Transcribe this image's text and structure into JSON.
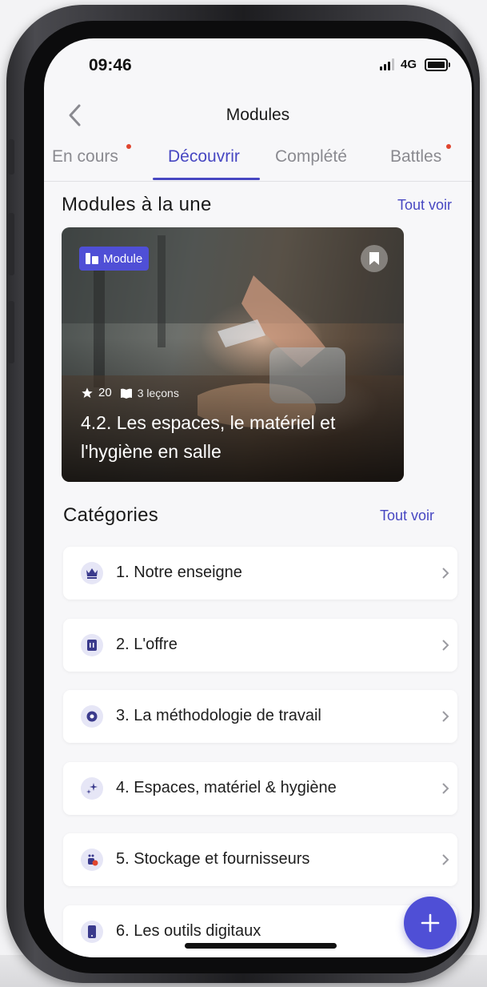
{
  "status_bar": {
    "time": "09:46",
    "network": "4G"
  },
  "nav": {
    "title": "Modules"
  },
  "tabs": [
    {
      "label": "En cours",
      "dot": true
    },
    {
      "label": "Découvrir",
      "active": true
    },
    {
      "label": "Complété"
    },
    {
      "label": "Battles",
      "dot": true
    }
  ],
  "featured": {
    "title": "Modules à la une",
    "see_all": "Tout voir",
    "card": {
      "badge": "Module",
      "stars": "20",
      "lessons": "3 leçons",
      "title": "4.2. Les espaces, le matériel et l'hygiène en salle"
    }
  },
  "categories": {
    "title": "Catégories",
    "see_all": "Tout voir",
    "items": [
      {
        "label": "1. Notre enseigne",
        "icon": "crown-icon"
      },
      {
        "label": "2. L'offre",
        "icon": "menu-card-icon"
      },
      {
        "label": "3. La méthodologie de travail",
        "icon": "gear-icon"
      },
      {
        "label": "4. Espaces, matériel & hygiène",
        "icon": "sparkles-icon"
      },
      {
        "label": "5. Stockage et fournisseurs",
        "icon": "supplies-icon"
      },
      {
        "label": "6. Les outils digitaux",
        "icon": "phone-icon"
      }
    ]
  },
  "colors": {
    "accent": "#4747c2",
    "fab": "#4f4fd6",
    "badge": "#4f4fd6",
    "notification_dot": "#e0452e"
  }
}
